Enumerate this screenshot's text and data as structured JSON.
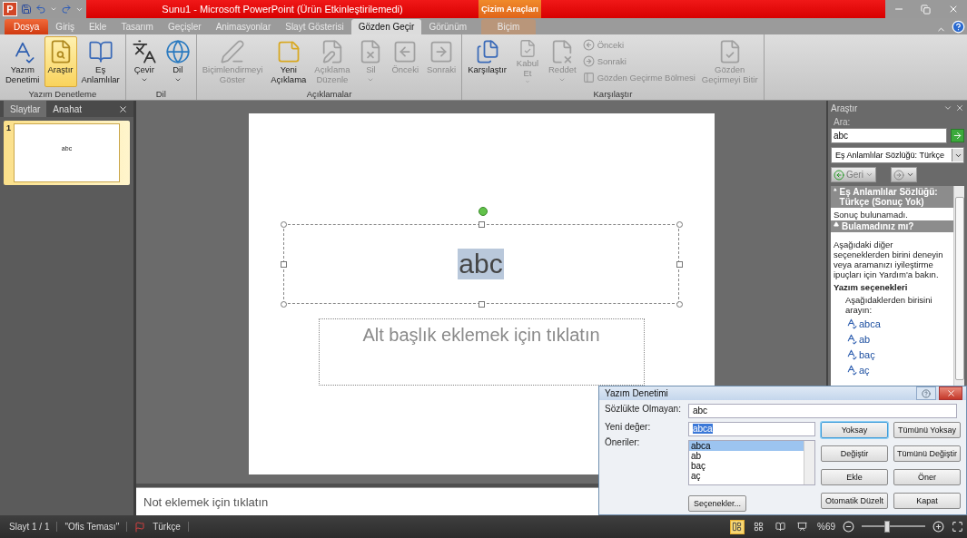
{
  "title_bar": {
    "app_logo": "P",
    "title": "Sunu1 - Microsoft PowerPoint (Ürün Etkinleştirilemedi)",
    "context_label": "Çizim Araçları"
  },
  "tabs": [
    {
      "label": "Dosya",
      "kind": "file",
      "selected": false
    },
    {
      "label": "Giriş",
      "kind": "normal",
      "selected": false
    },
    {
      "label": "Ekle",
      "kind": "normal",
      "selected": false
    },
    {
      "label": "Tasarım",
      "kind": "normal",
      "selected": false
    },
    {
      "label": "Geçişler",
      "kind": "normal",
      "selected": false
    },
    {
      "label": "Animasyonlar",
      "kind": "normal",
      "selected": false
    },
    {
      "label": "Slayt Gösterisi",
      "kind": "normal",
      "selected": false
    },
    {
      "label": "Gözden Geçir",
      "kind": "normal",
      "selected": true
    },
    {
      "label": "Görünüm",
      "kind": "normal",
      "selected": false
    },
    {
      "label": "Biçim",
      "kind": "contextual",
      "selected": false
    }
  ],
  "ribbon": {
    "groups": [
      {
        "label": "Yazım Denetleme",
        "items": [
          {
            "kind": "large",
            "label": "Yazım\nDenetimi",
            "disabled": false,
            "pressed": false
          },
          {
            "kind": "large",
            "label": "Araştır",
            "disabled": false,
            "pressed": true
          },
          {
            "kind": "large",
            "label": "Eş\nAnlamlılar",
            "disabled": false,
            "pressed": false
          }
        ]
      },
      {
        "label": "Dil",
        "items": [
          {
            "kind": "large",
            "label": "Çevir",
            "disabled": false,
            "pressed": false,
            "dropdown": true
          },
          {
            "kind": "large",
            "label": "Dil",
            "disabled": false,
            "pressed": false,
            "dropdown": true
          }
        ]
      },
      {
        "label": "Açıklamalar",
        "items": [
          {
            "kind": "large",
            "label": "Biçimlendirmeyi\nGöster",
            "disabled": true,
            "pressed": false
          },
          {
            "kind": "large",
            "label": "Yeni\nAçıklama",
            "disabled": false,
            "pressed": false
          },
          {
            "kind": "large",
            "label": "Açıklama\nDüzenle",
            "disabled": true,
            "pressed": false
          },
          {
            "kind": "large",
            "label": "Sil",
            "disabled": true,
            "pressed": false,
            "dropdown": true
          },
          {
            "kind": "large",
            "label": "Önceki",
            "disabled": true,
            "pressed": false
          },
          {
            "kind": "large",
            "label": "Sonraki",
            "disabled": true,
            "pressed": false
          }
        ]
      },
      {
        "label": "Karşılaştır",
        "items": [
          {
            "kind": "large",
            "label": "Karşılaştır",
            "disabled": false,
            "pressed": false
          },
          {
            "kind": "large",
            "label": "Kabul\nEt",
            "disabled": true,
            "pressed": false,
            "dropdown": true
          },
          {
            "kind": "large",
            "label": "Reddet",
            "disabled": true,
            "pressed": false,
            "dropdown": true
          },
          {
            "kind": "small",
            "label": "Önceki",
            "disabled": true
          },
          {
            "kind": "small",
            "label": "Sonraki",
            "disabled": true
          },
          {
            "kind": "small",
            "label": "Gözden Geçirme Bölmesi",
            "disabled": true
          },
          {
            "kind": "large",
            "label": "Gözden\nGeçirmeyi Bitir",
            "disabled": true,
            "pressed": false
          }
        ]
      }
    ]
  },
  "slides_panel": {
    "tabs": [
      {
        "label": "Slaytlar",
        "selected": true
      },
      {
        "label": "Anahat",
        "selected": false
      }
    ],
    "slides": [
      {
        "number": "1",
        "text": "abc",
        "selected": true
      }
    ]
  },
  "slide": {
    "title": "abc",
    "title_selected": true,
    "subtitle_placeholder": "Alt başlık eklemek için tıklatın"
  },
  "notes": {
    "placeholder": "Not eklemek için tıklatın"
  },
  "research_pane": {
    "title": "Araştır",
    "search_label": "Ara:",
    "search_value": "abc",
    "source": "Eş Anlamlılar Sözlüğü: Türkçe",
    "back_label": "Geri",
    "back_disabled": true,
    "results": {
      "heading_1": "Eş Anlamlılar Sözlüğü: Türkçe (Sonuç Yok)",
      "no_result": "Sonuç bulunamadı.",
      "heading_2": "Bulamadınız mı?",
      "hint": "Aşağıdaki diğer seçeneklerden birini deneyin veya aramanızı iyileştirme ipuçları için Yardım'a bakın.",
      "spelling_title": "Yazım seçenekleri",
      "spelling_hint": "Aşağıdaklerden birisini arayın:",
      "suggestions": [
        "abca",
        "ab",
        "baç",
        "aç"
      ]
    }
  },
  "spelling_dialog": {
    "title": "Yazım Denetimi",
    "not_in_dictionary_label": "Sözlükte Olmayan:",
    "not_in_dictionary_value": "abc",
    "new_value_label": "Yeni değer:",
    "new_value": "abca",
    "suggestions_label": "Öneriler:",
    "suggestions": [
      {
        "text": "abca",
        "selected": true
      },
      {
        "text": "ab",
        "selected": false
      },
      {
        "text": "baç",
        "selected": false
      },
      {
        "text": "aç",
        "selected": false
      }
    ],
    "options_button": "Seçenekler...",
    "buttons": [
      {
        "label": "Yoksay",
        "default": true
      },
      {
        "label": "Tümünü Yoksay",
        "default": false
      },
      {
        "label": "Değiştir",
        "default": false
      },
      {
        "label": "Tümünü Değiştir",
        "default": false
      },
      {
        "label": "Ekle",
        "default": false
      },
      {
        "label": "Öner",
        "default": false
      },
      {
        "label": "Otomatik Düzelt",
        "default": false
      },
      {
        "label": "Kapat",
        "default": false
      }
    ]
  },
  "status_bar": {
    "slide_info": "Slayt 1 / 1",
    "theme": "\"Ofis Teması\"",
    "language": "Türkçe",
    "views": [
      {
        "selected": true
      },
      {
        "selected": false
      },
      {
        "selected": false
      },
      {
        "selected": false
      }
    ],
    "zoom": "%69",
    "zoom_slider": {
      "level": 0.4
    }
  }
}
